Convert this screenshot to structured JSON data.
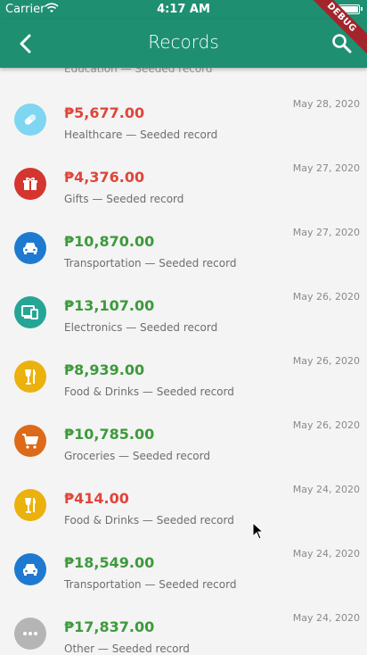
{
  "status": {
    "carrier": "Carrier",
    "time": "4:17 AM"
  },
  "appbar": {
    "title": "Records"
  },
  "debug_banner": "DEBUG",
  "colors": {
    "appbar": "#1f8f72",
    "expense": "#e0453a",
    "income": "#3d9a3c"
  },
  "peek_text": "Education — Seeded record",
  "records": [
    {
      "amount": "₱5,677.00",
      "category": "Healthcare",
      "note": "Seeded record",
      "date": "May 28, 2020",
      "kind": "expense",
      "icon": "pill-icon",
      "icon_color": "#7fd6f0"
    },
    {
      "amount": "₱4,376.00",
      "category": "Gifts",
      "note": "Seeded record",
      "date": "May 27, 2020",
      "kind": "expense",
      "icon": "gift-icon",
      "icon_color": "#d5352f"
    },
    {
      "amount": "₱10,870.00",
      "category": "Transportation",
      "note": "Seeded record",
      "date": "May 27, 2020",
      "kind": "income",
      "icon": "car-icon",
      "icon_color": "#1e7ad0"
    },
    {
      "amount": "₱13,107.00",
      "category": "Electronics",
      "note": "Seeded record",
      "date": "May 26, 2020",
      "kind": "income",
      "icon": "devices-icon",
      "icon_color": "#25a596"
    },
    {
      "amount": "₱8,939.00",
      "category": "Food & Drinks",
      "note": "Seeded record",
      "date": "May 26, 2020",
      "kind": "income",
      "icon": "food-icon",
      "icon_color": "#ebb10d"
    },
    {
      "amount": "₱10,785.00",
      "category": "Groceries",
      "note": "Seeded record",
      "date": "May 26, 2020",
      "kind": "income",
      "icon": "cart-icon",
      "icon_color": "#dd6a19"
    },
    {
      "amount": "₱414.00",
      "category": "Food & Drinks",
      "note": "Seeded record",
      "date": "May 24, 2020",
      "kind": "expense",
      "icon": "food-icon",
      "icon_color": "#ebb10d"
    },
    {
      "amount": "₱18,549.00",
      "category": "Transportation",
      "note": "Seeded record",
      "date": "May 24, 2020",
      "kind": "income",
      "icon": "car-icon",
      "icon_color": "#1e7ad0"
    },
    {
      "amount": "₱17,837.00",
      "category": "Other",
      "note": "Seeded record",
      "date": "May 24, 2020",
      "kind": "income",
      "icon": "more-icon",
      "icon_color": "#b5b5b5"
    }
  ]
}
